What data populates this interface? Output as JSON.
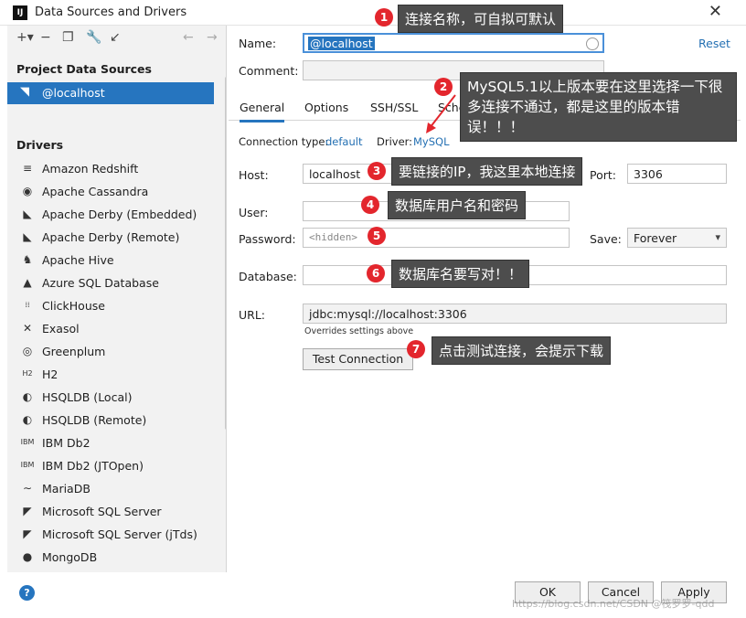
{
  "window": {
    "title": "Data Sources and Drivers",
    "app_icon_text": "IJ"
  },
  "left": {
    "project_heading": "Project Data Sources",
    "selected_source": "@localhost",
    "drivers_heading": "Drivers",
    "drivers": [
      {
        "name": "Amazon Redshift",
        "icon": "≡"
      },
      {
        "name": "Apache Cassandra",
        "icon": "◉"
      },
      {
        "name": "Apache Derby (Embedded)",
        "icon": "◣"
      },
      {
        "name": "Apache Derby (Remote)",
        "icon": "◣"
      },
      {
        "name": "Apache Hive",
        "icon": "♞"
      },
      {
        "name": "Azure SQL Database",
        "icon": "▲"
      },
      {
        "name": "ClickHouse",
        "icon": "⁞⁞"
      },
      {
        "name": "Exasol",
        "icon": "✕"
      },
      {
        "name": "Greenplum",
        "icon": "◎"
      },
      {
        "name": "H2",
        "icon": "H2"
      },
      {
        "name": "HSQLDB (Local)",
        "icon": "◐"
      },
      {
        "name": "HSQLDB (Remote)",
        "icon": "◐"
      },
      {
        "name": "IBM Db2",
        "icon": "IBM"
      },
      {
        "name": "IBM Db2 (JTOpen)",
        "icon": "IBM"
      },
      {
        "name": "MariaDB",
        "icon": "∼"
      },
      {
        "name": "Microsoft SQL Server",
        "icon": "◤"
      },
      {
        "name": "Microsoft SQL Server (jTds)",
        "icon": "◤"
      },
      {
        "name": "MongoDB",
        "icon": "●"
      }
    ]
  },
  "form": {
    "name_label": "Name:",
    "name_value": "@localhost",
    "reset": "Reset",
    "comment_label": "Comment:",
    "tabs": [
      "General",
      "Options",
      "SSH/SSL",
      "Sche"
    ],
    "conn_type_label": "Connection type:",
    "conn_type_value": "default",
    "driver_label": "Driver:",
    "driver_value": "MySQL",
    "host_label": "Host:",
    "host_value": "localhost",
    "port_label": "Port:",
    "port_value": "3306",
    "user_label": "User:",
    "password_label": "Password:",
    "password_placeholder": "<hidden>",
    "save_label": "Save:",
    "save_value": "Forever",
    "database_label": "Database:",
    "url_label": "URL:",
    "url_value": "jdbc:mysql://localhost:3306",
    "url_note": "Overrides settings above",
    "test_connection": "Test Connection"
  },
  "buttons": {
    "ok": "OK",
    "cancel": "Cancel",
    "apply": "Apply"
  },
  "annotations": [
    {
      "num": "1",
      "text": "连接名称，可自拟可默认"
    },
    {
      "num": "2",
      "text": "MySQL5.1以上版本要在这里选择一下很多连接不通过，都是这里的版本错误！！！"
    },
    {
      "num": "3",
      "text": "要链接的IP，我这里本地连接"
    },
    {
      "num": "4",
      "text": "数据库用户名和密码"
    },
    {
      "num": "5",
      "text": ""
    },
    {
      "num": "6",
      "text": "数据库名要写对！！"
    },
    {
      "num": "7",
      "text": "点击测试连接，会提示下载"
    }
  ],
  "watermark": "https://blog.csdn.net/CSDN @筏罗罗-qdd",
  "colors": {
    "accent": "#2675bf",
    "link": "#2470b3",
    "badge": "#e3262d",
    "callout": "#4d4d4d"
  }
}
